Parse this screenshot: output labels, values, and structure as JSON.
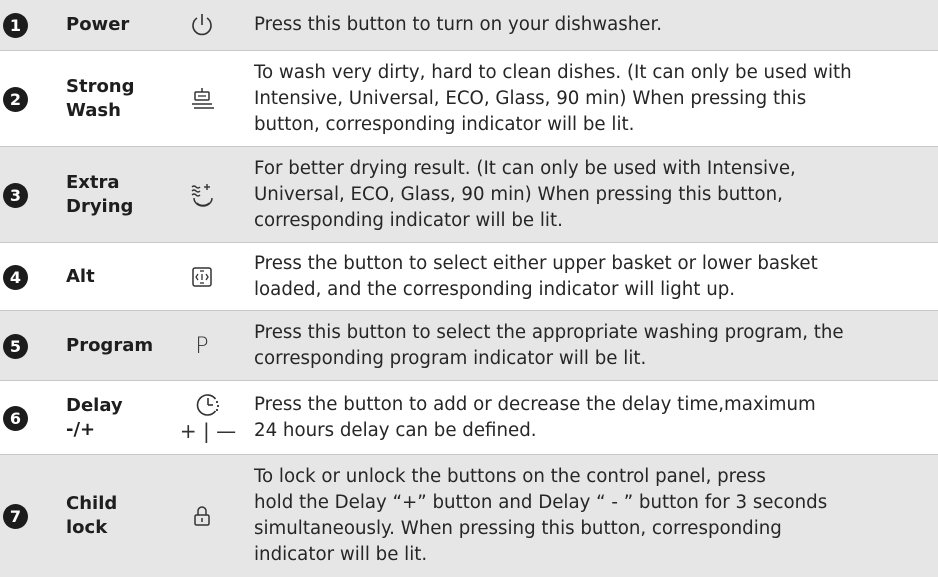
{
  "rows": [
    {
      "number": "1",
      "name": "Power",
      "icon": "power-icon",
      "description": "Press this button to turn on your dishwasher."
    },
    {
      "number": "2",
      "name": "Strong\nWash",
      "icon": "strong-wash-icon",
      "description": "To wash very dirty, hard to clean dishes. (It can only be used with\nIntensive, Universal, ECO, Glass, 90 min) When pressing this\nbutton, corresponding indicator will be lit."
    },
    {
      "number": "3",
      "name": "Extra\nDrying",
      "icon": "extra-drying-icon",
      "description": "For better drying result. (It can only be used with Intensive,\nUniversal, ECO, Glass, 90 min) When pressing this button,\ncorresponding indicator will be lit."
    },
    {
      "number": "4",
      "name": "Alt",
      "icon": "alt-basket-icon",
      "description": "Press the button to select either upper basket or lower basket\nloaded, and the corresponding indicator will light up."
    },
    {
      "number": "5",
      "name": "Program",
      "icon_text": "P",
      "icon": "program-icon",
      "description": "Press this button to select the appropriate washing program, the\ncorresponding program indicator will be lit."
    },
    {
      "number": "6",
      "name": "Delay\n-/+",
      "icon": "delay-icon",
      "icon_text": "+ | —",
      "description": "Press the button to add or decrease the delay time,maximum\n24 hours delay can be defined."
    },
    {
      "number": "7",
      "name": "Child\nlock",
      "icon": "child-lock-icon",
      "description": "To lock or unlock the buttons on the control panel, press\nhold the Delay “+” button and Delay “ - ” button for 3 seconds\nsimultaneously. When pressing this button, corresponding\nindicator will be lit."
    }
  ]
}
